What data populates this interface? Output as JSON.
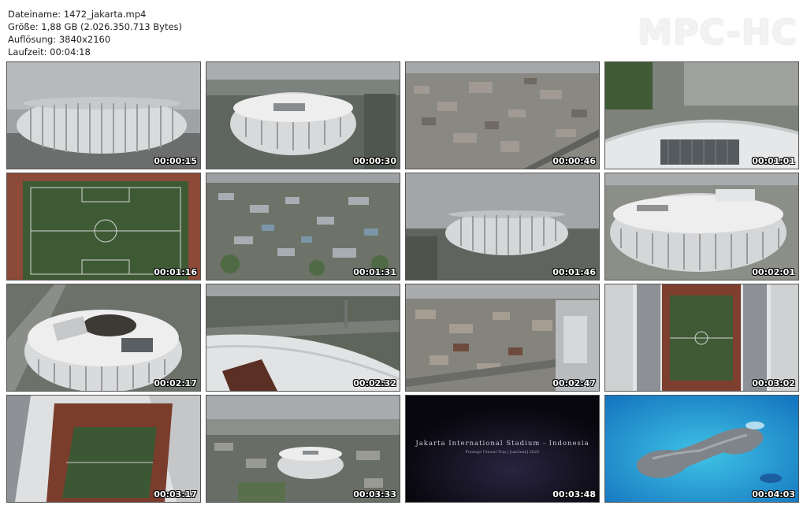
{
  "info": {
    "filename": "Dateiname: 1472_jakarta.mp4",
    "size": "Größe: 1,88 GB (2.026.350.713 Bytes)",
    "resolution": "Auflösung: 3840x2160",
    "duration": "Laufzeit: 00:04:18"
  },
  "brand": "MPC-HC",
  "thumbnails": [
    {
      "time": "00:00:15",
      "scene": "stadium-side-view"
    },
    {
      "time": "00:00:30",
      "scene": "stadium-aerial-oblique"
    },
    {
      "time": "00:00:46",
      "scene": "city-aerial"
    },
    {
      "time": "00:01:01",
      "scene": "stadium-roof-closeup"
    },
    {
      "time": "00:01:16",
      "scene": "football-pitch-topdown"
    },
    {
      "time": "00:01:31",
      "scene": "suburb-aerial"
    },
    {
      "time": "00:01:46",
      "scene": "stadium-distant"
    },
    {
      "time": "00:02:01",
      "scene": "stadium-oblique-roof"
    },
    {
      "time": "00:02:17",
      "scene": "stadium-open-roof"
    },
    {
      "time": "00:02:32",
      "scene": "stadium-roof-edge"
    },
    {
      "time": "00:02:47",
      "scene": "city-dense-aerial"
    },
    {
      "time": "00:03:02",
      "scene": "pitch-topdown-roof"
    },
    {
      "time": "00:03:17",
      "scene": "pitch-angled-roof"
    },
    {
      "time": "00:03:33",
      "scene": "stadium-far-city"
    },
    {
      "time": "00:03:48",
      "scene": "title-card",
      "title": "Jakarta International Stadium - Indonesia",
      "subtitle": "Footage Unreal Trip | [unclear] 2022"
    },
    {
      "time": "00:04:03",
      "scene": "tropical-island"
    }
  ]
}
